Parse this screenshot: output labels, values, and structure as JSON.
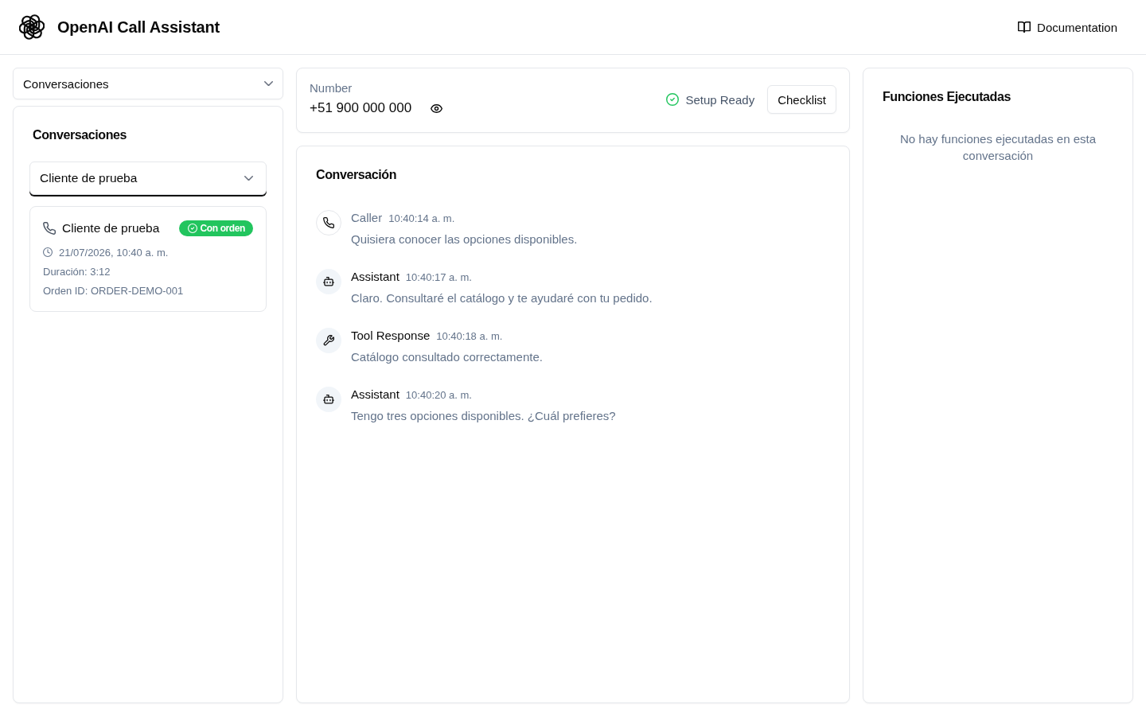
{
  "header": {
    "title": "OpenAI Call Assistant",
    "documentation_link": "Documentation"
  },
  "left": {
    "view_select": {
      "value": "Conversaciones"
    },
    "panel": {
      "title": "Conversaciones",
      "filter_select": {
        "value": "Cliente de prueba"
      },
      "conversations": [
        {
          "name": "Cliente de prueba",
          "badge": "Con orden",
          "date": "21/07/2026, 10:40 a. m.",
          "duration": "Duración: 3:12",
          "order_id": "Orden ID: ORDER-DEMO-001"
        }
      ]
    }
  },
  "phone": {
    "label": "Number",
    "number": "+51 900 000 000",
    "status": "Setup Ready",
    "checklist_button": "Checklist"
  },
  "conversation": {
    "title": "Conversación",
    "messages": [
      {
        "kind": "caller",
        "role": "Caller",
        "time": "10:40:14 a. m.",
        "text": "Quisiera conocer las opciones disponibles."
      },
      {
        "kind": "assistant",
        "role": "Assistant",
        "time": "10:40:17 a. m.",
        "text": "Claro. Consultaré el catálogo y te ayudaré con tu pedido."
      },
      {
        "kind": "tool",
        "role": "Tool Response",
        "time": "10:40:18 a. m.",
        "text": "Catálogo consultado correctamente."
      },
      {
        "kind": "assistant",
        "role": "Assistant",
        "time": "10:40:20 a. m.",
        "text": "Tengo tres opciones disponibles. ¿Cuál prefieres?"
      }
    ]
  },
  "functions": {
    "title": "Funciones Ejecutadas",
    "empty_text": "No hay funciones ejecutadas en esta conversación"
  }
}
